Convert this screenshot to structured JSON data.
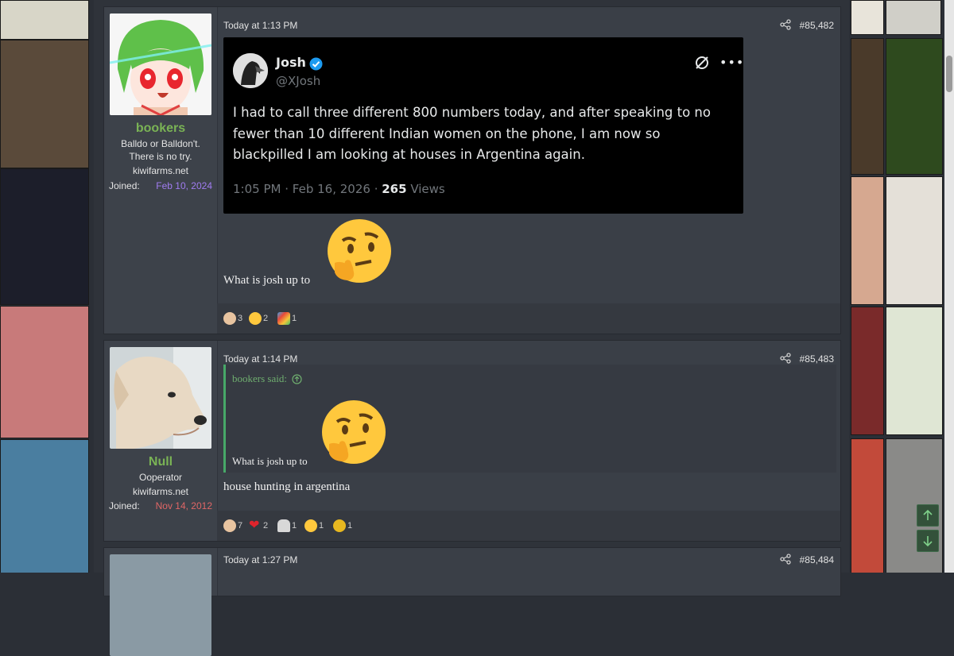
{
  "posts": [
    {
      "username": "bookers",
      "user_title_lines": [
        "Balldo or Balldon't.",
        "There is no try."
      ],
      "user_site": "kiwifarms.net",
      "joined_label": "Joined:",
      "joined_date": "Feb 10, 2024",
      "time": "Today at 1:13 PM",
      "post_number": "#85,482",
      "tweet": {
        "name": "Josh",
        "handle": "@XJosh",
        "text": "I had to call three different 800 numbers today, and after speaking to no fewer than 10 different Indian women on the phone, I am now so blackpilled I am looking at houses in Argentina again.",
        "time": "1:05 PM",
        "date": "Feb 16, 2026",
        "views_count": "265",
        "views_label": "Views"
      },
      "body": "What is josh up to",
      "reactions": [
        "3",
        "2",
        "1"
      ]
    },
    {
      "username": "Null",
      "user_title_lines": [
        "Ooperator"
      ],
      "user_site": "kiwifarms.net",
      "joined_label": "Joined:",
      "joined_date": "Nov 14, 2012",
      "time": "Today at 1:14 PM",
      "post_number": "#85,483",
      "quote_attribution": "bookers said:",
      "quote_text": "What is josh up to",
      "body": "house hunting in argentina",
      "reactions": [
        "7",
        "2",
        "1",
        "1",
        "1"
      ]
    },
    {
      "time": "Today at 1:27 PM",
      "post_number": "#85,484"
    }
  ],
  "colors": {
    "username": "#7ab355",
    "joined_date_1": "#a07cf0",
    "joined_date_2": "#e06666",
    "accent_green": "#47a868"
  },
  "icons": [
    "share-icon",
    "verified-icon",
    "grok-icon",
    "more-icon",
    "thinking-face-emoji",
    "arrow-up-icon",
    "arrow-down-icon"
  ]
}
